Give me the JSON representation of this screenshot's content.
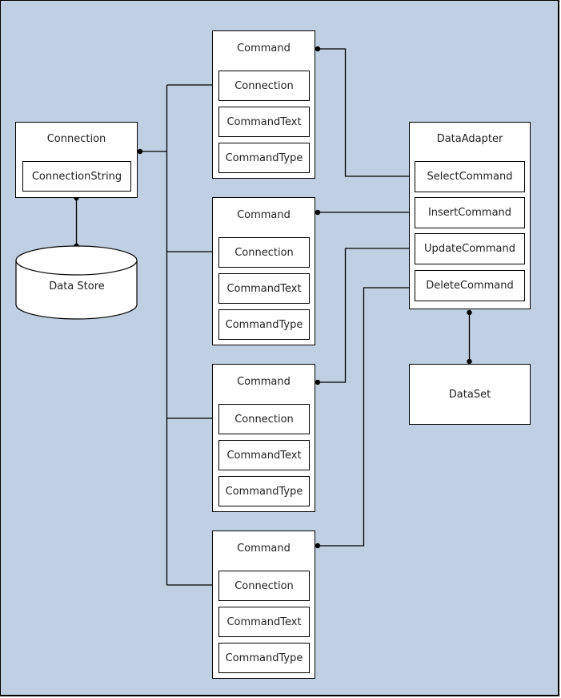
{
  "diagram": {
    "connection": {
      "title": "Connection",
      "fields": [
        "ConnectionString"
      ]
    },
    "data_store": {
      "label": "Data Store"
    },
    "commands": [
      {
        "title": "Command",
        "fields": [
          "Connection",
          "CommandText",
          "CommandType"
        ]
      },
      {
        "title": "Command",
        "fields": [
          "Connection",
          "CommandText",
          "CommandType"
        ]
      },
      {
        "title": "Command",
        "fields": [
          "Connection",
          "CommandText",
          "CommandType"
        ]
      },
      {
        "title": "Command",
        "fields": [
          "Connection",
          "CommandText",
          "CommandType"
        ]
      }
    ],
    "data_adapter": {
      "title": "DataAdapter",
      "fields": [
        "SelectCommand",
        "InsertCommand",
        "UpdateCommand",
        "DeleteCommand"
      ]
    },
    "data_set": {
      "label": "DataSet"
    },
    "connections": [
      {
        "from": "connection",
        "to": "data_store"
      },
      {
        "from": "connection",
        "to": "command-1.Connection"
      },
      {
        "from": "connection",
        "to": "command-2.Connection"
      },
      {
        "from": "connection",
        "to": "command-3.Connection"
      },
      {
        "from": "connection",
        "to": "command-4.Connection"
      },
      {
        "from": "command-1",
        "to": "data_adapter.SelectCommand"
      },
      {
        "from": "command-2",
        "to": "data_adapter.InsertCommand"
      },
      {
        "from": "command-3",
        "to": "data_adapter.UpdateCommand"
      },
      {
        "from": "command-4",
        "to": "data_adapter.DeleteCommand"
      },
      {
        "from": "data_adapter",
        "to": "data_set"
      }
    ]
  }
}
